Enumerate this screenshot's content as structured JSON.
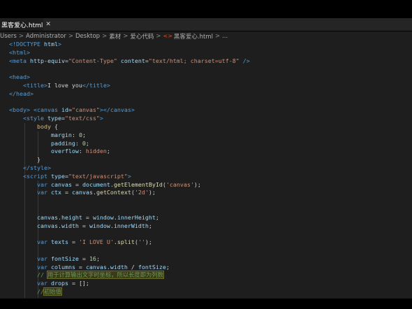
{
  "tab": {
    "label": "黑客爱心.html",
    "close_glyph": "✕"
  },
  "breadcrumb": {
    "items": [
      "Users",
      "Administrator",
      "Desktop",
      "素材",
      "爱心代码",
      "黑客爱心.html",
      "..."
    ],
    "separator": ">",
    "html_icon": "<>"
  },
  "code_lines": [
    [
      [
        "doctype",
        "<!DOCTYPE "
      ],
      [
        "dt-html",
        "html"
      ],
      [
        "doctype",
        ">"
      ]
    ],
    [
      [
        "tag",
        "<html>"
      ]
    ],
    [
      [
        "tag",
        "<meta "
      ],
      [
        "attr",
        "http-equiv"
      ],
      [
        "plain",
        "="
      ],
      [
        "str",
        "\"Content-Type\""
      ],
      [
        "plain",
        " "
      ],
      [
        "attr",
        "content"
      ],
      [
        "plain",
        "="
      ],
      [
        "str",
        "\"text/html; charset=utf-8\""
      ],
      [
        "plain",
        " "
      ],
      [
        "tag",
        "/>"
      ]
    ],
    [],
    [
      [
        "tag",
        "<head>"
      ]
    ],
    [
      [
        "plain",
        "    "
      ],
      [
        "tag",
        "<title>"
      ],
      [
        "plain",
        "I love you"
      ],
      [
        "tag",
        "</title>"
      ]
    ],
    [
      [
        "tag",
        "</head>"
      ]
    ],
    [],
    [
      [
        "tag",
        "<body>"
      ],
      [
        "plain",
        " "
      ],
      [
        "tag",
        "<canvas "
      ],
      [
        "attr",
        "id"
      ],
      [
        "plain",
        "="
      ],
      [
        "str",
        "\"canvas\""
      ],
      [
        "tag",
        "></canvas>"
      ]
    ],
    [
      [
        "plain",
        "    "
      ],
      [
        "tag",
        "<style "
      ],
      [
        "attr",
        "type"
      ],
      [
        "plain",
        "="
      ],
      [
        "str",
        "\"text/css\""
      ],
      [
        "tag",
        ">"
      ]
    ],
    [
      [
        "plain",
        "        "
      ],
      [
        "sel",
        "body"
      ],
      [
        "plain",
        " {"
      ]
    ],
    [
      [
        "plain",
        "            "
      ],
      [
        "prop",
        "margin"
      ],
      [
        "plain",
        ": "
      ],
      [
        "num",
        "0"
      ],
      [
        "plain",
        ";"
      ]
    ],
    [
      [
        "plain",
        "            "
      ],
      [
        "prop",
        "padding"
      ],
      [
        "plain",
        ": "
      ],
      [
        "num",
        "0"
      ],
      [
        "plain",
        ";"
      ]
    ],
    [
      [
        "plain",
        "            "
      ],
      [
        "prop",
        "overflow"
      ],
      [
        "plain",
        ": "
      ],
      [
        "str",
        "hidden"
      ],
      [
        "plain",
        ";"
      ]
    ],
    [
      [
        "plain",
        "        }"
      ]
    ],
    [
      [
        "plain",
        "    "
      ],
      [
        "tag",
        "</style>"
      ]
    ],
    [
      [
        "plain",
        "    "
      ],
      [
        "tag",
        "<script "
      ],
      [
        "attr",
        "type"
      ],
      [
        "plain",
        "="
      ],
      [
        "str",
        "\"text/javascript\""
      ],
      [
        "tag",
        ">"
      ]
    ],
    [
      [
        "plain",
        "        "
      ],
      [
        "kw",
        "var"
      ],
      [
        "plain",
        " "
      ],
      [
        "var",
        "canvas"
      ],
      [
        "plain",
        " = "
      ],
      [
        "var",
        "document"
      ],
      [
        "plain",
        "."
      ],
      [
        "fn",
        "getElementById"
      ],
      [
        "plain",
        "("
      ],
      [
        "str",
        "'canvas'"
      ],
      [
        "plain",
        ");"
      ]
    ],
    [
      [
        "plain",
        "        "
      ],
      [
        "kw",
        "var"
      ],
      [
        "plain",
        " "
      ],
      [
        "var",
        "ctx"
      ],
      [
        "plain",
        " = "
      ],
      [
        "var",
        "canvas"
      ],
      [
        "plain",
        "."
      ],
      [
        "fn",
        "getContext"
      ],
      [
        "plain",
        "("
      ],
      [
        "str",
        "'2d'"
      ],
      [
        "plain",
        ");"
      ]
    ],
    [],
    [],
    [
      [
        "plain",
        "        "
      ],
      [
        "var",
        "canvas"
      ],
      [
        "plain",
        "."
      ],
      [
        "var",
        "height"
      ],
      [
        "plain",
        " = "
      ],
      [
        "var",
        "window"
      ],
      [
        "plain",
        "."
      ],
      [
        "var",
        "innerHeight"
      ],
      [
        "plain",
        ";"
      ]
    ],
    [
      [
        "plain",
        "        "
      ],
      [
        "var",
        "canvas"
      ],
      [
        "plain",
        "."
      ],
      [
        "var",
        "width"
      ],
      [
        "plain",
        " = "
      ],
      [
        "var",
        "window"
      ],
      [
        "plain",
        "."
      ],
      [
        "var",
        "innerWidth"
      ],
      [
        "plain",
        ";"
      ]
    ],
    [],
    [
      [
        "plain",
        "        "
      ],
      [
        "kw",
        "var"
      ],
      [
        "plain",
        " "
      ],
      [
        "var",
        "texts"
      ],
      [
        "plain",
        " = "
      ],
      [
        "str",
        "'I LOVE U'"
      ],
      [
        "plain",
        "."
      ],
      [
        "fn",
        "split"
      ],
      [
        "plain",
        "("
      ],
      [
        "str",
        "''"
      ],
      [
        "plain",
        ");"
      ]
    ],
    [],
    [
      [
        "plain",
        "        "
      ],
      [
        "kw",
        "var"
      ],
      [
        "plain",
        " "
      ],
      [
        "var",
        "fontSize"
      ],
      [
        "plain",
        " = "
      ],
      [
        "num",
        "16"
      ],
      [
        "plain",
        ";"
      ]
    ],
    [
      [
        "plain",
        "        "
      ],
      [
        "kw",
        "var"
      ],
      [
        "plain",
        " "
      ],
      [
        "var",
        "columns"
      ],
      [
        "plain",
        " = "
      ],
      [
        "var",
        "canvas"
      ],
      [
        "plain",
        "."
      ],
      [
        "var",
        "width"
      ],
      [
        "plain",
        " / "
      ],
      [
        "var",
        "fontSize"
      ],
      [
        "plain",
        ";"
      ]
    ],
    [
      [
        "plain",
        "        "
      ],
      [
        "cmt",
        "// "
      ],
      [
        "cmt-hl",
        "用于计算输出文字时坐标，所以长度即为列数"
      ]
    ],
    [
      [
        "plain",
        "        "
      ],
      [
        "kw",
        "var"
      ],
      [
        "plain",
        " "
      ],
      [
        "var",
        "drops"
      ],
      [
        "plain",
        " = [];"
      ]
    ],
    [
      [
        "plain",
        "        "
      ],
      [
        "cmt",
        "//"
      ],
      [
        "cmt-hl",
        "初始值"
      ]
    ]
  ],
  "colors": {
    "background": "#000000",
    "editor": "#1e1e1e",
    "tabbar": "#252526"
  }
}
